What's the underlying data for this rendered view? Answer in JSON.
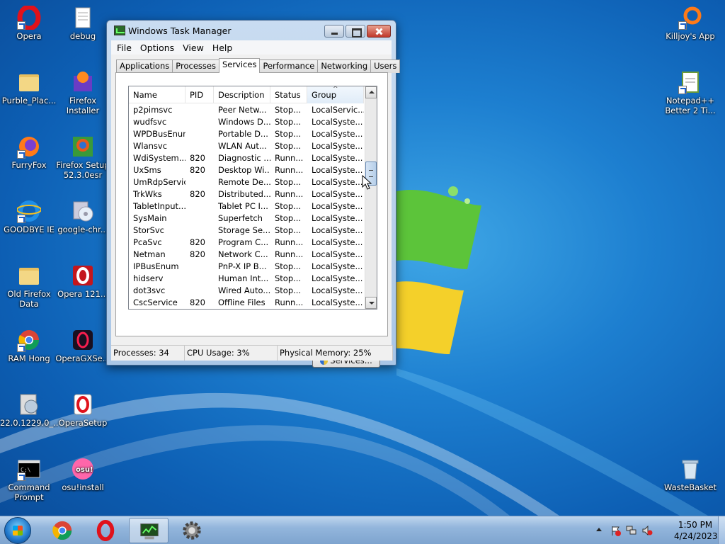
{
  "desktop": {
    "icons_left_col1": [
      {
        "label": "Opera",
        "icon": "opera-icon"
      },
      {
        "label": "Purble_Plac...",
        "icon": "folder-icon"
      },
      {
        "label": "FurryFox",
        "icon": "firefox-icon"
      },
      {
        "label": "GOODBYE IE",
        "icon": "ie-icon"
      },
      {
        "label": "Old Firefox Data",
        "icon": "folder-icon"
      },
      {
        "label": "RAM Hong",
        "icon": "chrome-icon"
      },
      {
        "label": "22.0.1229.0_...",
        "icon": "installer-icon"
      },
      {
        "label": "Command Prompt",
        "icon": "cmd-icon"
      }
    ],
    "icons_left_col2": [
      {
        "label": "debug",
        "icon": "text-file-icon"
      },
      {
        "label": "Firefox Installer",
        "icon": "firefox-installer-icon"
      },
      {
        "label": "Firefox Setup 52.3.0esr",
        "icon": "setup-icon"
      },
      {
        "label": "google-chr...",
        "icon": "cd-installer-icon"
      },
      {
        "label": "Opera 121...",
        "icon": "opera-setup-icon"
      },
      {
        "label": "OperaGXSe...",
        "icon": "opera-gx-icon"
      },
      {
        "label": "OperaSetup",
        "icon": "opera-setup-icon"
      },
      {
        "label": "osu!install",
        "icon": "osu-icon"
      }
    ],
    "icons_right": [
      {
        "label": "Killjoy's App",
        "icon": "app-icon"
      },
      {
        "label": "Notepad++ Better 2 Ti...",
        "icon": "notepad-icon"
      },
      {
        "label": "WasteBasket",
        "icon": "recycle-bin-icon"
      }
    ]
  },
  "window": {
    "title": "Windows Task Manager",
    "menu": [
      "File",
      "Options",
      "View",
      "Help"
    ],
    "tabs": [
      "Applications",
      "Processes",
      "Services",
      "Performance",
      "Networking",
      "Users"
    ],
    "active_tab": "Services",
    "columns": [
      "Name",
      "PID",
      "Description",
      "Status",
      "Group"
    ],
    "sort_indicator": "^",
    "rows": [
      [
        "p2pimsvc",
        "",
        "Peer Netw...",
        "Stop...",
        "LocalServic..."
      ],
      [
        "wudfsvc",
        "",
        "Windows D...",
        "Stop...",
        "LocalSyste..."
      ],
      [
        "WPDBusEnum",
        "",
        "Portable D...",
        "Stop...",
        "LocalSyste..."
      ],
      [
        "Wlansvc",
        "",
        "WLAN Aut...",
        "Stop...",
        "LocalSyste..."
      ],
      [
        "WdiSystem...",
        "820",
        "Diagnostic ...",
        "Runn...",
        "LocalSyste..."
      ],
      [
        "UxSms",
        "820",
        "Desktop Wi...",
        "Runn...",
        "LocalSyste..."
      ],
      [
        "UmRdpService",
        "",
        "Remote De...",
        "Stop...",
        "LocalSyste..."
      ],
      [
        "TrkWks",
        "820",
        "Distributed...",
        "Runn...",
        "LocalSyste..."
      ],
      [
        "TabletInput...",
        "",
        "Tablet PC I...",
        "Stop...",
        "LocalSyste..."
      ],
      [
        "SysMain",
        "",
        "Superfetch",
        "Stop...",
        "LocalSyste..."
      ],
      [
        "StorSvc",
        "",
        "Storage Se...",
        "Stop...",
        "LocalSyste..."
      ],
      [
        "PcaSvc",
        "820",
        "Program C...",
        "Runn...",
        "LocalSyste..."
      ],
      [
        "Netman",
        "820",
        "Network C...",
        "Runn...",
        "LocalSyste..."
      ],
      [
        "IPBusEnum",
        "",
        "PnP-X IP B...",
        "Stop...",
        "LocalSyste..."
      ],
      [
        "hidserv",
        "",
        "Human Int...",
        "Stop...",
        "LocalSyste..."
      ],
      [
        "dot3svc",
        "",
        "Wired Auto...",
        "Stop...",
        "LocalSyste..."
      ],
      [
        "CscService",
        "820",
        "Offline Files",
        "Runn...",
        "LocalSyste..."
      ]
    ],
    "services_button": "Services...",
    "status": {
      "processes": "Processes: 34",
      "cpu": "CPU Usage: 3%",
      "memory": "Physical Memory: 25%"
    }
  },
  "taskbar": {
    "pinned": [
      "chrome-icon",
      "opera-icon",
      "task-manager-icon",
      "settings-gear-icon"
    ],
    "clock_time": "1:50 PM",
    "clock_date": "4/24/2023"
  },
  "colors": {
    "desktop_blue": "#1d7fd0",
    "flag_green": "#5cc43a",
    "flag_yellow": "#f4d02a"
  }
}
